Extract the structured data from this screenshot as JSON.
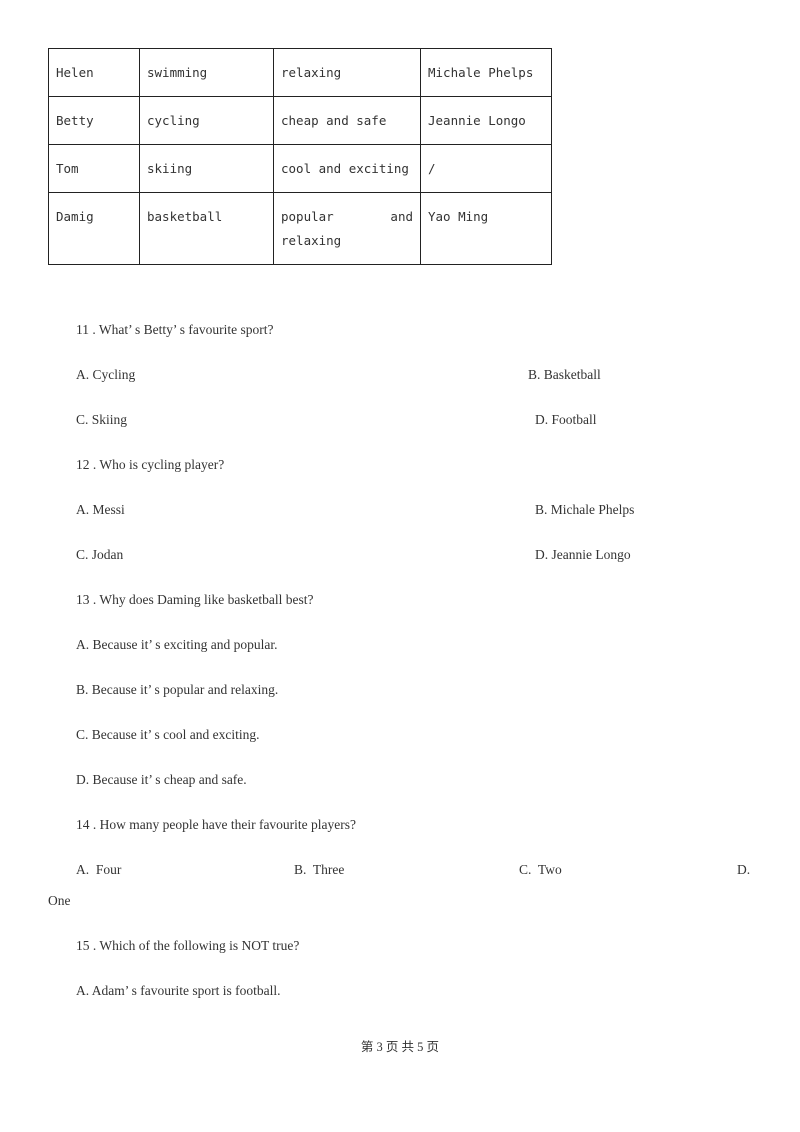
{
  "table": {
    "rows": [
      [
        "Helen",
        "swimming",
        "relaxing",
        "Michale Phelps"
      ],
      [
        "Betty",
        "cycling",
        "cheap and safe",
        "Jeannie Longo"
      ],
      [
        "Tom",
        "skiing",
        "cool and exciting",
        "/"
      ],
      [
        "Damig",
        "basketball",
        "popular and relaxing",
        "Yao Ming"
      ]
    ],
    "wrapped_cell": {
      "line1_left": "popular",
      "line1_right": "and",
      "line2": "relaxing"
    }
  },
  "questions": [
    {
      "number": "11 .",
      "text": "What’ s Betty’ s favourite sport?",
      "options": {
        "A": "A. Cycling",
        "B": "B. Basketball",
        "C": "C. Skiing",
        "D": "D. Football"
      }
    },
    {
      "number": "12 .",
      "text": "Who is cycling player?",
      "options": {
        "A": "A. Messi",
        "B": "B. Michale Phelps",
        "C": "C. Jodan",
        "D": "D. Jeannie Longo"
      }
    },
    {
      "number": "13 .",
      "text": "Why does Daming like basketball best?",
      "options": {
        "A": "A. Because it’ s exciting and popular.",
        "B": "B. Because it’ s popular and relaxing.",
        "C": "C. Because it’ s cool and exciting.",
        "D": "D. Because it’ s cheap and safe."
      }
    },
    {
      "number": "14 .",
      "text": "How many people have their favourite players?",
      "options": {
        "A": "A.  Four",
        "B": "B.  Three",
        "C": "C.  Two",
        "D": "D.",
        "D_wrap": "One"
      }
    },
    {
      "number": "15 .",
      "text": "Which of the following is NOT true?",
      "options": {
        "A": "A. Adam’ s favourite sport is football."
      }
    }
  ],
  "footer": "第 3 页 共 5 页"
}
